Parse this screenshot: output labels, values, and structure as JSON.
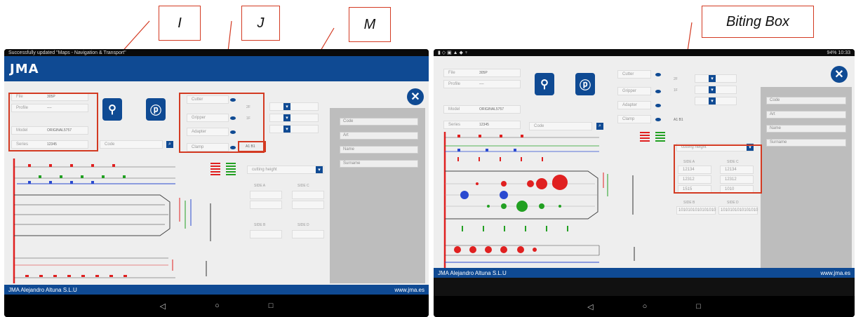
{
  "callouts": {
    "i": "I",
    "j": "J",
    "m": "M",
    "biting_box": "Biting Box"
  },
  "left_tablet": {
    "status_text": "Successfully updated \"Maps - Navigation & Transport\"",
    "logo": "JMA",
    "fields": {
      "file_label": "File",
      "file_value": "305P",
      "profile_label": "Profile",
      "profile_value": "----",
      "model_label": "Model",
      "model_value": "ORIGINAL5757",
      "series_label": "Series",
      "series_value": "12345",
      "code_label": "Code"
    },
    "options": {
      "cutter": "Cutter",
      "gripper": "Gripper",
      "adapter": "Adapter",
      "clamp": "Clamp"
    },
    "side_labels": [
      "2F",
      "1F"
    ],
    "counter": "A1 B1",
    "panel_fields": [
      "Code",
      "Art",
      "Name",
      "Surname"
    ],
    "cutting_select": "cutting height",
    "sides": {
      "a": "SIDE A",
      "b": "SIDE B",
      "c": "SIDE C",
      "d": "SIDE D"
    },
    "footer_company": "JMA Alejandro Altuna S.L.U",
    "footer_url": "www.jma.es"
  },
  "right_tablet": {
    "status_right": "94% 10:33",
    "fields": {
      "file_label": "File",
      "file_value": "305P",
      "profile_label": "Profile",
      "profile_value": "----",
      "model_label": "Model",
      "model_value": "ORIGINAL5757",
      "series_label": "Series",
      "series_value": "12345",
      "code_label": "Code"
    },
    "options": {
      "cutter": "Cutter",
      "gripper": "Gripper",
      "adapter": "Adapter",
      "clamp": "Clamp"
    },
    "side_labels": [
      "2F",
      "1F"
    ],
    "counter": "A1 B1",
    "panel_fields": [
      "Code",
      "Art",
      "Name",
      "Surname"
    ],
    "cutting_select": "cutting height",
    "biting": {
      "side_a": "SIDE A",
      "side_c": "SIDE C",
      "a_values": [
        "12134",
        "12312",
        "1515"
      ],
      "c_values": [
        "12134",
        "12312",
        "1010"
      ],
      "side_b": "SIDE B",
      "side_d": "SIDE D",
      "b_value": "1010101010101010",
      "d_value": "1010101010101010"
    },
    "footer_company": "JMA Alejandro Altuna S.L.U",
    "footer_url": "www.jma.es"
  },
  "nav": {
    "back": "◁",
    "home": "○",
    "recent": "□"
  },
  "colors": {
    "brand_blue": "#0f4a93",
    "callout_red": "#d33a22"
  }
}
